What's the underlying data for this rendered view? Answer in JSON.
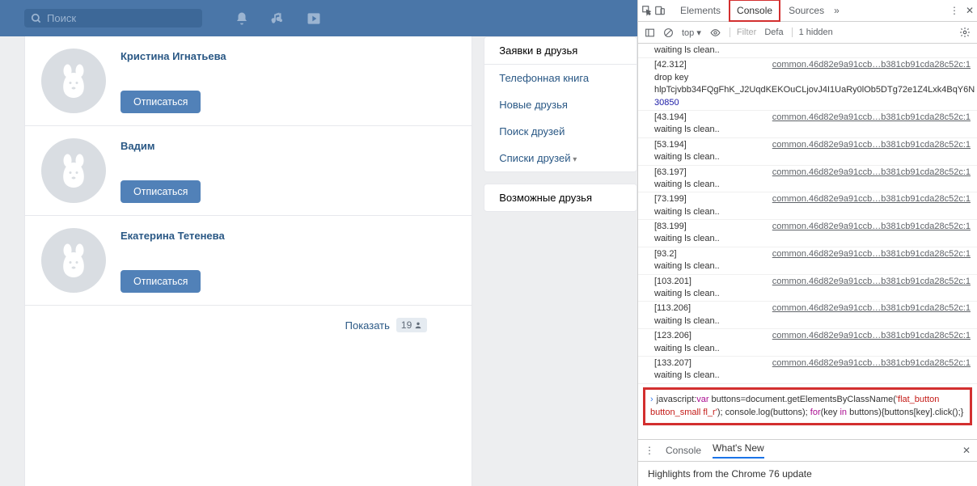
{
  "topbar": {
    "search_placeholder": "Поиск"
  },
  "people": [
    {
      "name": "Кристина Игнатьева",
      "btn": "Отписаться"
    },
    {
      "name": "Вадим",
      "btn": "Отписаться"
    },
    {
      "name": "Екатерина Тетенева",
      "btn": "Отписаться"
    }
  ],
  "footer": {
    "show_label": "Показать",
    "count": "19",
    "icon": "person"
  },
  "sidebar": {
    "items": [
      "Заявки в друзья",
      "Телефонная книга",
      "Новые друзья",
      "Поиск друзей",
      "Списки друзей"
    ],
    "possible_header": "Возможные друзья"
  },
  "devtools": {
    "tabs": {
      "elements": "Elements",
      "console": "Console",
      "sources": "Sources"
    },
    "toolbar": {
      "context": "top",
      "filter": "Filter",
      "default": "Defa",
      "hidden": "1 hidden"
    },
    "first_partial": "waiting ls clean..",
    "logs": [
      {
        "ts": "[42.312]",
        "src": "common.46d82e9a91ccb…b381cb91cda28c52c:1",
        "msg": "drop key\nhlpTcjvbb34FQgFhK_J2UqdKEKOuCLjovJ4I1UaRy0lOb5DTg72e1Z4Lxk4BqY6N 30850"
      },
      {
        "ts": "[43.194]",
        "src": "common.46d82e9a91ccb…b381cb91cda28c52c:1",
        "msg": "waiting ls clean.."
      },
      {
        "ts": "[53.194]",
        "src": "common.46d82e9a91ccb…b381cb91cda28c52c:1",
        "msg": "waiting ls clean.."
      },
      {
        "ts": "[63.197]",
        "src": "common.46d82e9a91ccb…b381cb91cda28c52c:1",
        "msg": "waiting ls clean.."
      },
      {
        "ts": "[73.199]",
        "src": "common.46d82e9a91ccb…b381cb91cda28c52c:1",
        "msg": "waiting ls clean.."
      },
      {
        "ts": "[83.199]",
        "src": "common.46d82e9a91ccb…b381cb91cda28c52c:1",
        "msg": "waiting ls clean.."
      },
      {
        "ts": "[93.2]",
        "src": "common.46d82e9a91ccb…b381cb91cda28c52c:1",
        "msg": "waiting ls clean.."
      },
      {
        "ts": "[103.201]",
        "src": "common.46d82e9a91ccb…b381cb91cda28c52c:1",
        "msg": "waiting ls clean.."
      },
      {
        "ts": "[113.206]",
        "src": "common.46d82e9a91ccb…b381cb91cda28c52c:1",
        "msg": "waiting ls clean.."
      },
      {
        "ts": "[123.206]",
        "src": "common.46d82e9a91ccb…b381cb91cda28c52c:1",
        "msg": "waiting ls clean.."
      },
      {
        "ts": "[133.207]",
        "src": "common.46d82e9a91ccb…b381cb91cda28c52c:1",
        "msg": "waiting ls clean.."
      }
    ],
    "input_code": {
      "p1": "javascript:",
      "p2": "var",
      "p3": " buttons=document.getElementsByClassName(",
      "p4": "'flat_button button_small fl_r'",
      "p5": "); console.log(buttons); ",
      "p6": "for",
      "p7": "(key ",
      "p8": "in",
      "p9": " buttons){buttons[key].click();}"
    },
    "drawer": {
      "console": "Console",
      "whatsnew": "What's New",
      "headline": "Highlights from the Chrome 76 update"
    }
  }
}
